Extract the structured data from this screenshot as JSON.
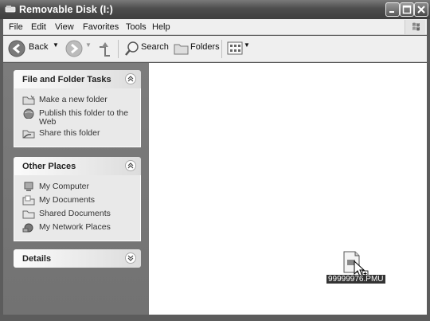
{
  "window": {
    "title": "Removable Disk (I:)"
  },
  "menubar": {
    "items": [
      "File",
      "Edit",
      "View",
      "Favorites",
      "Tools",
      "Help"
    ]
  },
  "toolbar": {
    "back_label": "Back",
    "search_label": "Search",
    "folders_label": "Folders"
  },
  "tasks_panel": {
    "title": "File and Folder Tasks",
    "items": [
      {
        "label": "Make a new folder",
        "icon": "new-folder-icon"
      },
      {
        "label": "Publish this folder to the Web",
        "icon": "publish-web-icon"
      },
      {
        "label": "Share this folder",
        "icon": "share-folder-icon"
      }
    ]
  },
  "places_panel": {
    "title": "Other Places",
    "items": [
      {
        "label": "My Computer",
        "icon": "my-computer-icon"
      },
      {
        "label": "My Documents",
        "icon": "my-documents-icon"
      },
      {
        "label": "Shared Documents",
        "icon": "shared-documents-icon"
      },
      {
        "label": "My Network Places",
        "icon": "network-places-icon"
      }
    ]
  },
  "details_panel": {
    "title": "Details"
  },
  "content": {
    "files": [
      {
        "name": "99999976.PMU",
        "icon": "file-icon",
        "selected": true
      }
    ]
  }
}
